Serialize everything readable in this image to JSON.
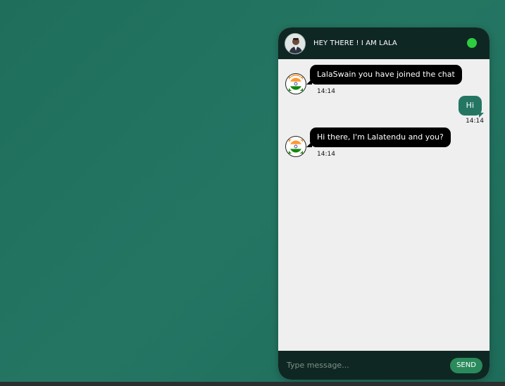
{
  "header": {
    "title": "HEY THERE ! I AM LALA",
    "status_color": "#2ecc40"
  },
  "messages": [
    {
      "direction": "incoming",
      "text": "LalaSwain you have joined the chat",
      "time": "14:14",
      "avatar": "india-flag-icon"
    },
    {
      "direction": "outgoing",
      "text": "Hi",
      "time": "14:14"
    },
    {
      "direction": "incoming",
      "text": "Hi there, I'm Lalatendu and you?",
      "time": "14:14",
      "avatar": "india-flag-icon"
    }
  ],
  "composer": {
    "placeholder": "Type message...",
    "send_label": "SEND"
  },
  "colors": {
    "background": "#1f6e5c",
    "header": "#0f2722",
    "outgoing_bubble": "#247663",
    "incoming_bubble": "#000000",
    "send_button": "#2a8a5c"
  }
}
